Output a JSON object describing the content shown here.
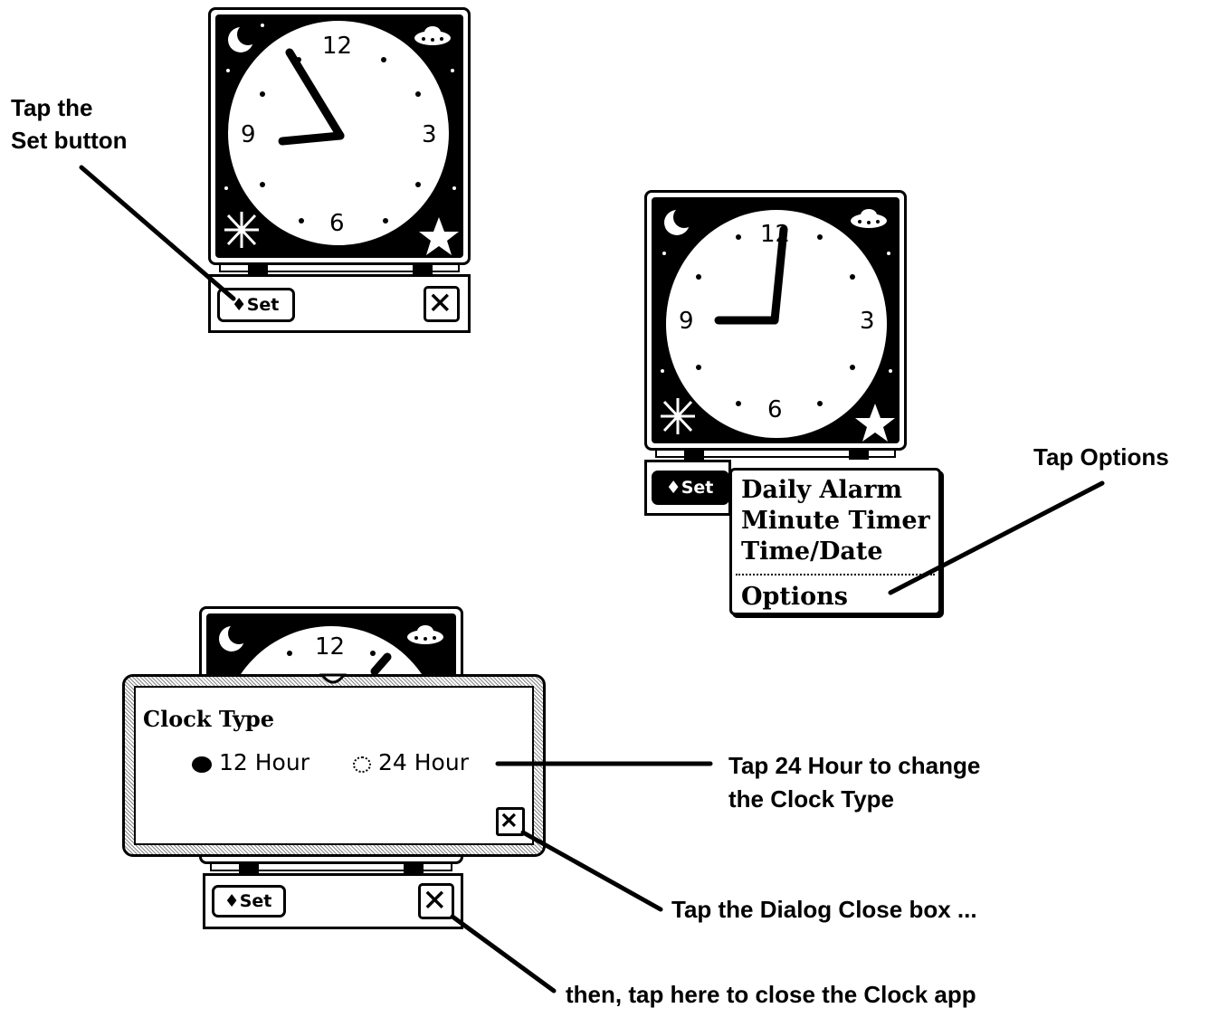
{
  "clock_face_numbers": {
    "twelve": "12",
    "three": "3",
    "six": "6",
    "nine": "9"
  },
  "set_button_label": "♦Set",
  "menu": {
    "items": [
      "Daily Alarm",
      "Minute Timer",
      "Time/Date"
    ],
    "options": "Options"
  },
  "dialog": {
    "title": "Clock Type",
    "option_12": "12 Hour",
    "option_24": "24 Hour",
    "selected": "12 Hour"
  },
  "callouts": {
    "set_line1": "Tap the",
    "set_line2": "Set button",
    "options": "Tap Options",
    "hour_line1": "Tap 24 Hour to change",
    "hour_line2": "the Clock Type",
    "dialog_close": "Tap the Dialog Close box ...",
    "app_close": "then, tap here to close the Clock app"
  },
  "icons": [
    "moon-icon",
    "ufo-icon",
    "star-burst-icon",
    "star-icon",
    "close-icon",
    "diamond-icon"
  ]
}
